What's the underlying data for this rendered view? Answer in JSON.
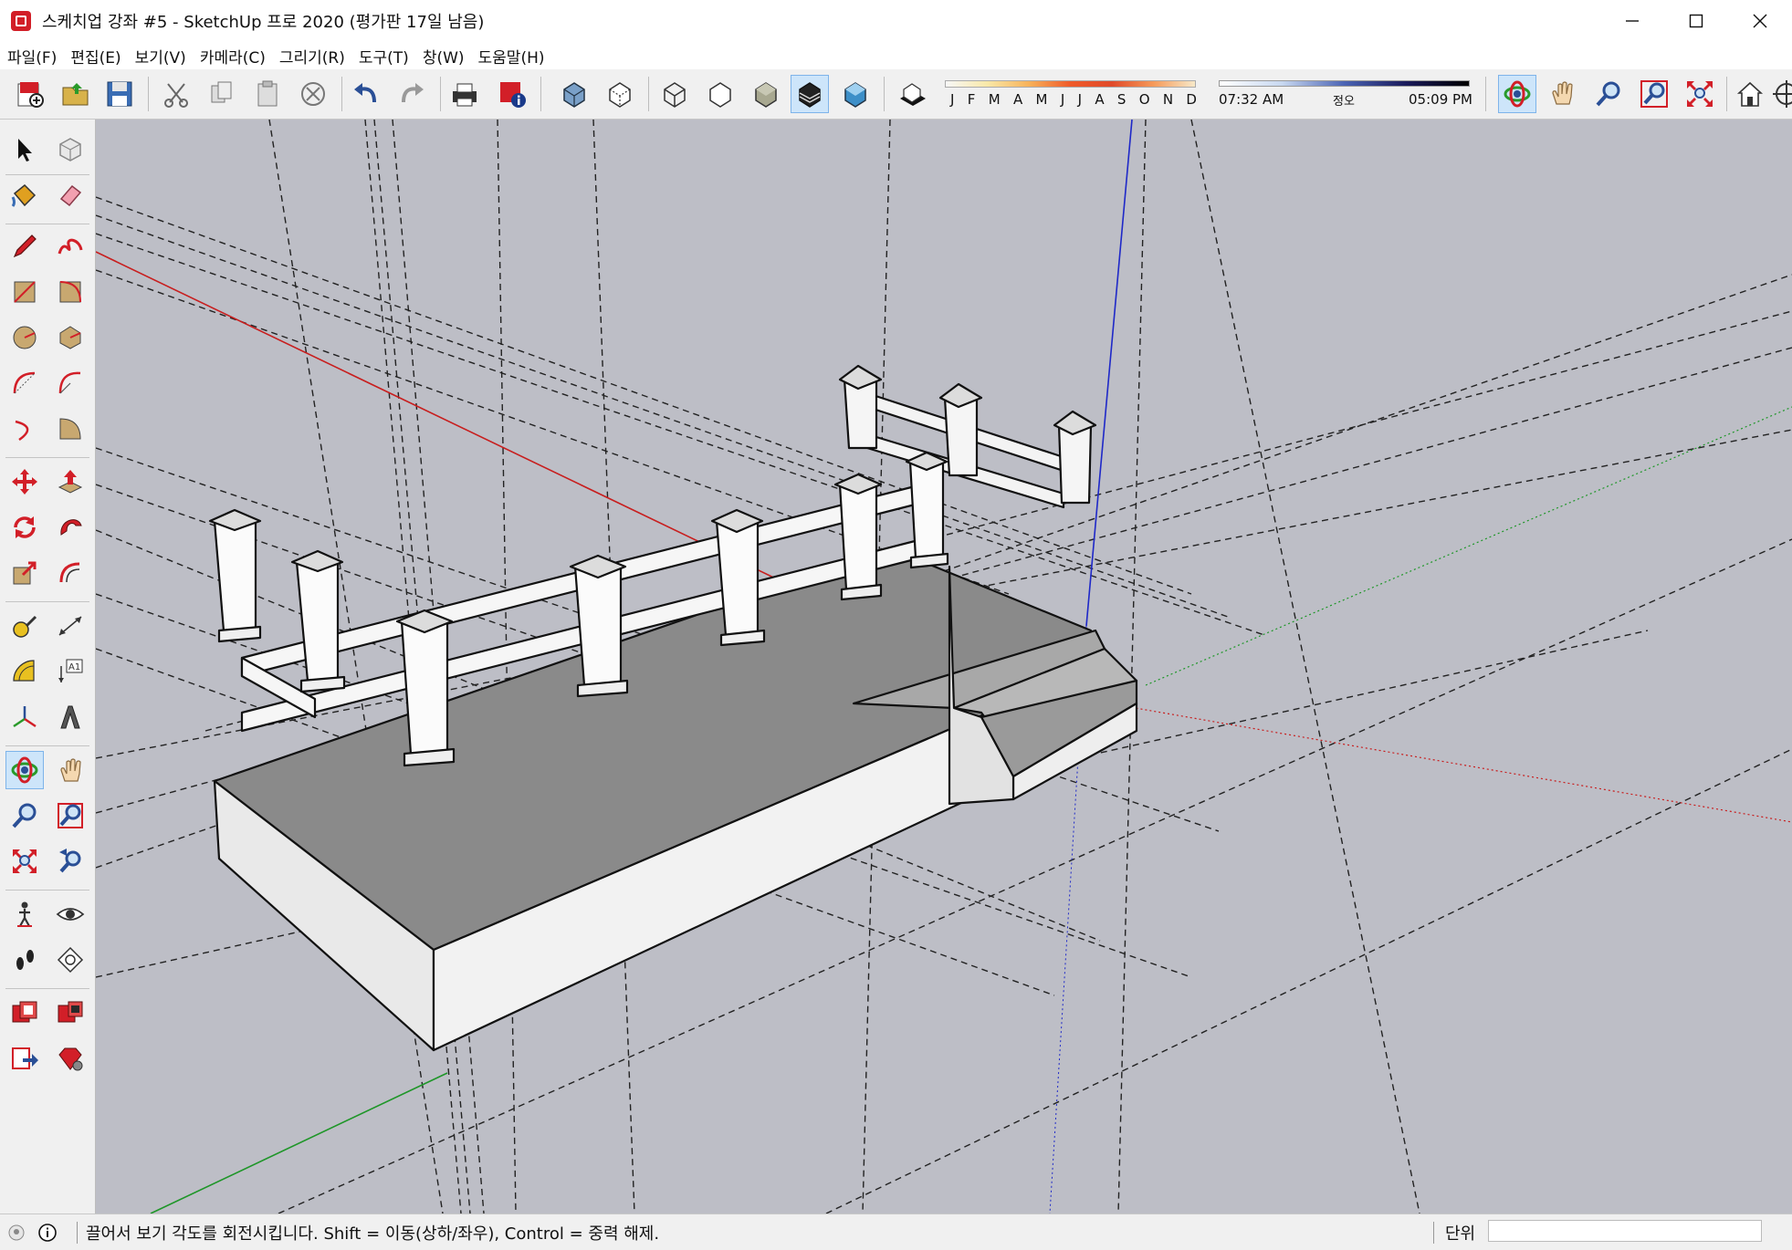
{
  "window": {
    "title": "스케치업 강좌 #5 - SketchUp 프로 2020 (평가판 17일 남음)"
  },
  "menu": {
    "items": [
      "파일(F)",
      "편집(E)",
      "보기(V)",
      "카메라(C)",
      "그리기(R)",
      "도구(T)",
      "창(W)",
      "도움말(H)"
    ]
  },
  "shadow": {
    "months": [
      "J",
      "F",
      "M",
      "A",
      "M",
      "J",
      "J",
      "A",
      "S",
      "O",
      "N",
      "D"
    ],
    "time_start": "07:32 AM",
    "time_noon": "정오",
    "time_end": "05:09 PM"
  },
  "status": {
    "message": "끌어서 보기 각도를 회전시킵니다. Shift = 이동(상하/좌우), Control = 중력 해제.",
    "unit_label": "단위",
    "unit_value": ""
  },
  "colors": {
    "viewport_bg": "#bdbec6",
    "red_axis": "#c81e1e",
    "green_axis": "#1e9628",
    "blue_axis": "#1e28c8",
    "active_tool": "#cde5fa"
  }
}
